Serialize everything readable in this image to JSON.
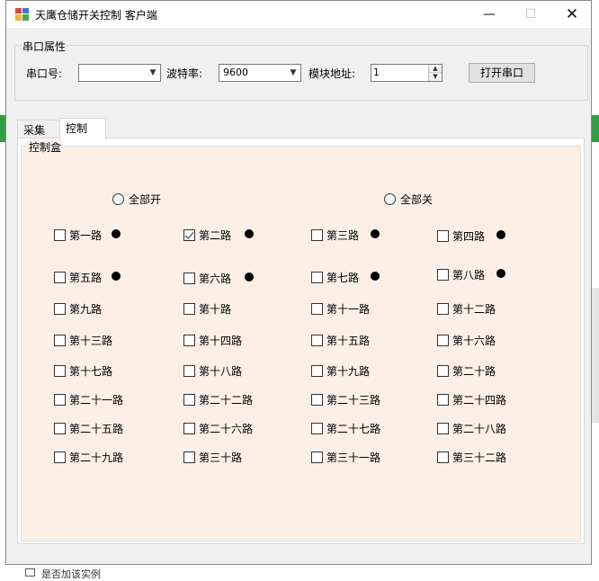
{
  "window": {
    "title": "天鹰仓储开关控制 客户端",
    "min_glyph": "—",
    "max_glyph": "☐",
    "close_glyph": "✕"
  },
  "background_app": {
    "checkbox_label": "是否加该实例"
  },
  "serial": {
    "group_title": "串口属性",
    "port_label": "串口号:",
    "port_value": "",
    "baud_label": "波特率:",
    "baud_value": "9600",
    "address_label": "模块地址:",
    "address_value": "1",
    "open_button": "打开串口"
  },
  "tabs": [
    {
      "label": "采集"
    },
    {
      "label": "控制"
    }
  ],
  "control": {
    "group_title": "控制盒",
    "all_on": "全部开",
    "all_off": "全部关",
    "channels": [
      {
        "label": "第一路",
        "checked": false
      },
      {
        "label": "第二路",
        "checked": true
      },
      {
        "label": "第三路",
        "checked": false
      },
      {
        "label": "第四路",
        "checked": false
      },
      {
        "label": "第五路",
        "checked": false
      },
      {
        "label": "第六路",
        "checked": false
      },
      {
        "label": "第七路",
        "checked": false
      },
      {
        "label": "第八路",
        "checked": false
      },
      {
        "label": "第九路",
        "checked": false
      },
      {
        "label": "第十路",
        "checked": false
      },
      {
        "label": "第十一路",
        "checked": false
      },
      {
        "label": "第十二路",
        "checked": false
      },
      {
        "label": "第十三路",
        "checked": false
      },
      {
        "label": "第十四路",
        "checked": false
      },
      {
        "label": "第十五路",
        "checked": false
      },
      {
        "label": "第十六路",
        "checked": false
      },
      {
        "label": "第十七路",
        "checked": false
      },
      {
        "label": "第十八路",
        "checked": false
      },
      {
        "label": "第十九路",
        "checked": false
      },
      {
        "label": "第二十路",
        "checked": false
      },
      {
        "label": "第二十一路",
        "checked": false
      },
      {
        "label": "第二十二路",
        "checked": false
      },
      {
        "label": "第二十三路",
        "checked": false
      },
      {
        "label": "第二十四路",
        "checked": false
      },
      {
        "label": "第二十五路",
        "checked": false
      },
      {
        "label": "第二十六路",
        "checked": false
      },
      {
        "label": "第二十七路",
        "checked": false
      },
      {
        "label": "第二十八路",
        "checked": false
      },
      {
        "label": "第二十九路",
        "checked": false
      },
      {
        "label": "第三十路",
        "checked": false
      },
      {
        "label": "第三十一路",
        "checked": false
      },
      {
        "label": "第三十二路",
        "checked": false
      }
    ]
  }
}
